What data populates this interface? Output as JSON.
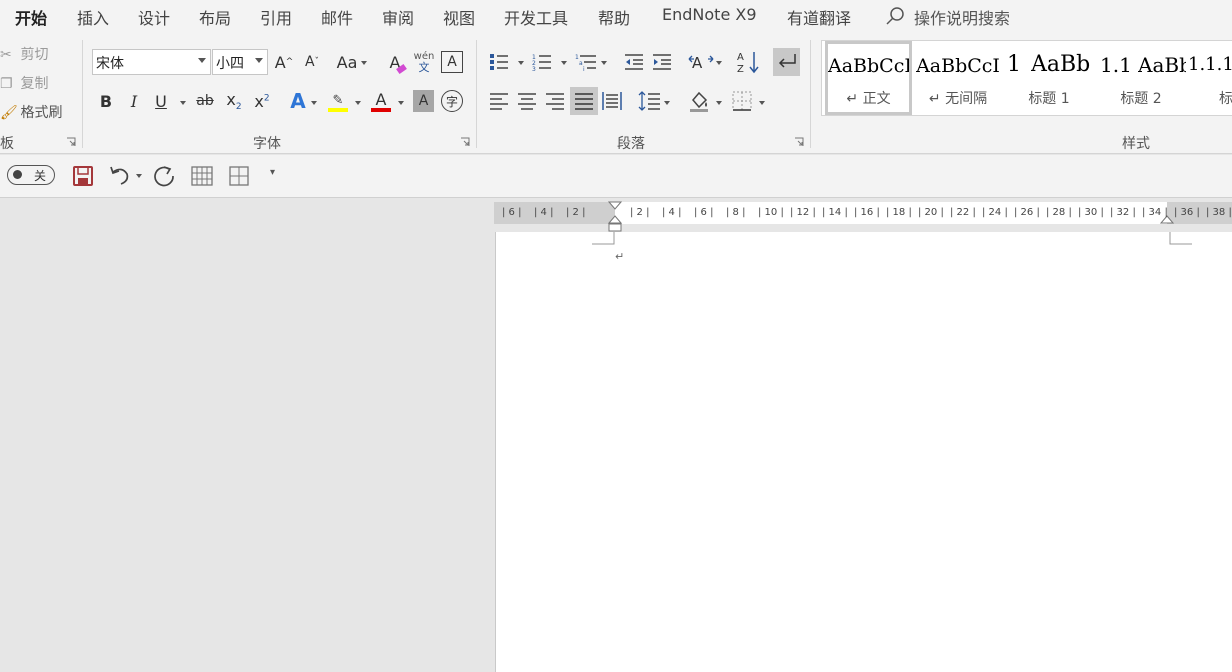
{
  "menu": {
    "tabs": [
      "开始",
      "插入",
      "设计",
      "布局",
      "引用",
      "邮件",
      "审阅",
      "视图",
      "开发工具",
      "帮助",
      "EndNote X9",
      "有道翻译"
    ],
    "active_tab": "开始",
    "search_label": "操作说明搜索"
  },
  "clipboard": {
    "cut": "剪切",
    "copy": "复制",
    "format_painter": "格式刷",
    "group_label": "板"
  },
  "font": {
    "name": "宋体",
    "size": "小四",
    "group_label": "字体",
    "change_case": "Aa",
    "phonetic_top": "wén",
    "phonetic_bottom": "文",
    "bold": "B",
    "italic": "I",
    "underline": "U",
    "strike": "ab",
    "subscript_base": "x",
    "subscript_mark": "2",
    "superscript_base": "x",
    "superscript_mark": "2",
    "text_effect": "A",
    "font_color_letter": "A",
    "char_shading": "A",
    "enclose_char": "字",
    "grow": "A",
    "shrink": "A",
    "clear_format": "A",
    "char_border": "A",
    "highlight_color": "#ffff00",
    "font_color": "#e00000"
  },
  "paragraph": {
    "group_label": "段落"
  },
  "styles": {
    "group_label": "样式",
    "items": [
      {
        "preview": "AaBbCcI",
        "name": "↵ 正文"
      },
      {
        "preview": "AaBbCcI",
        "name": "↵ 无间隔"
      },
      {
        "preview": "1",
        "name": ""
      },
      {
        "preview": "AaBb",
        "name": "标题 1"
      },
      {
        "preview": "1.1",
        "name": ""
      },
      {
        "preview": "AaBb",
        "name": "标题 2"
      },
      {
        "preview": "1.1.1",
        "name": "标题"
      }
    ]
  },
  "qat": {
    "toggle_label": "关"
  },
  "ruler": {
    "ticks": [
      "6",
      "4",
      "2",
      "",
      "2",
      "4",
      "6",
      "8",
      "10",
      "12",
      "14",
      "16",
      "18",
      "20",
      "22",
      "24",
      "26",
      "28",
      "30",
      "32",
      "34",
      "36",
      "38"
    ]
  },
  "document": {
    "paragraph_mark": "↵"
  },
  "colors": {
    "accent": "#2b579a",
    "save_icon": "#a4373a"
  }
}
